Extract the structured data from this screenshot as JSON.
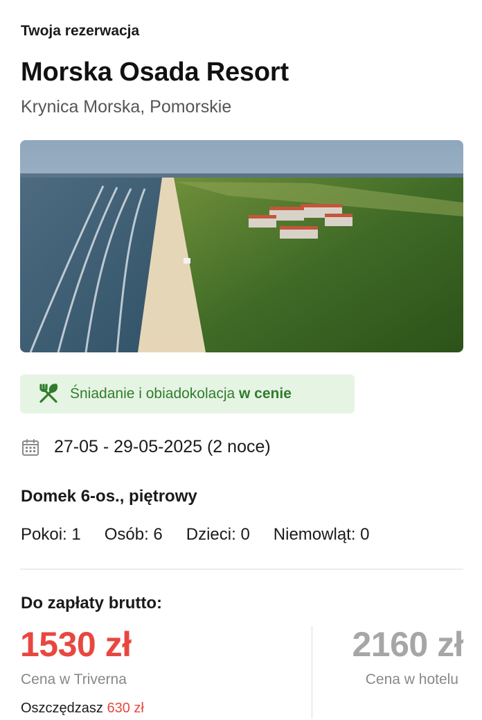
{
  "booking": {
    "eyebrow": "Twoja rezerwacja",
    "hotel_name": "Morska Osada Resort",
    "location": "Krynica Morska, Pomorskie"
  },
  "meal": {
    "icon": "fork-knife-icon",
    "text_prefix": "Śniadanie i obiadokolacja ",
    "text_bold": "w cenie",
    "color": "#2f7d2c",
    "background": "#e6f4e4"
  },
  "dates": {
    "icon": "calendar-icon",
    "text": "27-05 - 29-05-2025 (2 noce)"
  },
  "room": {
    "name": "Domek 6-os., piętrowy",
    "occupancy": [
      "Pokoi: 1",
      "Osób: 6",
      "Dzieci: 0",
      "Niemowląt: 0"
    ]
  },
  "payment": {
    "label": "Do zapłaty brutto:",
    "our_price": "1530 zł",
    "our_price_caption": "Cena w Triverna",
    "savings_label": "Oszczędzasz ",
    "savings_amount": "630 zł",
    "hotel_price": "2160 zł",
    "hotel_price_caption": "Cena w hotelu",
    "accent_color": "#e8473f",
    "muted_color": "#a6a6a6"
  }
}
